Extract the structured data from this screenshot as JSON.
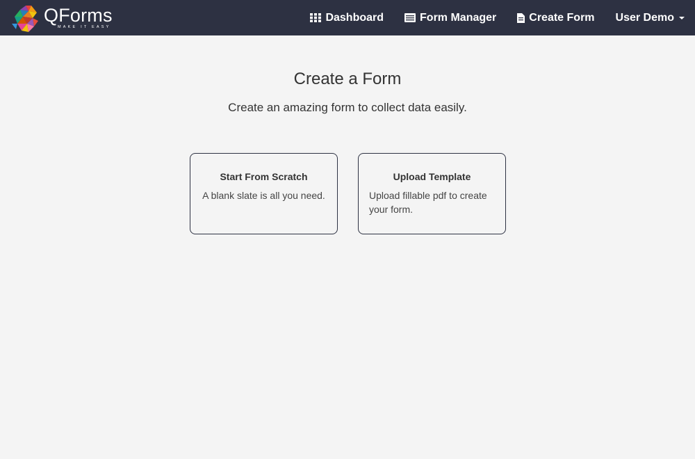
{
  "brand": {
    "name": "QForms",
    "tagline": "MAKE IT EASY"
  },
  "nav": {
    "items": [
      {
        "label": "Dashboard",
        "icon": "grid-icon"
      },
      {
        "label": "Form Manager",
        "icon": "list-icon"
      },
      {
        "label": "Create Form",
        "icon": "document-edit-icon"
      },
      {
        "label": "User Demo",
        "icon": "chevron-down-icon"
      }
    ]
  },
  "page": {
    "title": "Create a Form",
    "subtitle": "Create an amazing form to collect data easily."
  },
  "cards": [
    {
      "title": "Start From Scratch",
      "description": "A blank slate is all you need."
    },
    {
      "title": "Upload Template",
      "description": "Upload fillable pdf to create your form."
    }
  ],
  "colors": {
    "navbar": "#2d3142",
    "background": "#f4f4f4",
    "card_border": "#2d3142"
  }
}
